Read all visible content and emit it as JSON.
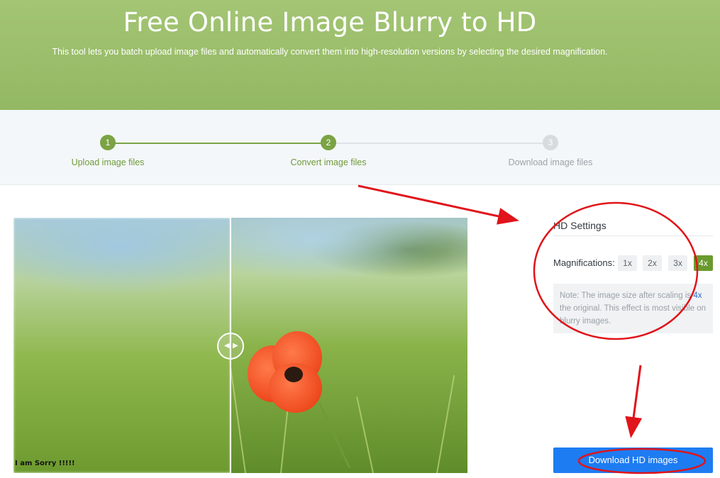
{
  "hero": {
    "title": "Free Online Image Blurry to HD",
    "subtitle": "This tool lets you batch upload image files and automatically convert them into high-resolution versions by selecting the desired magnification."
  },
  "steps": [
    {
      "num": "1",
      "label": "Upload image files",
      "state": "done"
    },
    {
      "num": "2",
      "label": "Convert image files",
      "state": "done"
    },
    {
      "num": "3",
      "label": "Download image files",
      "state": "todo"
    }
  ],
  "preview": {
    "watermark_text": "I am Sorry !!!!!",
    "handle_left_icon": "chevron-left-icon",
    "handle_right_icon": "chevron-right-icon"
  },
  "settings": {
    "title": "HD Settings",
    "magnifications_label": "Magnifications:",
    "options": [
      "1x",
      "2x",
      "3x",
      "4x"
    ],
    "selected": "4x",
    "note_prefix": "Note: The image size after scaling is",
    "note_highlight": "4x",
    "note_suffix": "the original. This effect is most visible on blurry images."
  },
  "download_button": "Download HD images",
  "colors": {
    "brand_green": "#7ba344",
    "download_blue": "#1e7cf2",
    "annotation_red": "#e0141a"
  }
}
